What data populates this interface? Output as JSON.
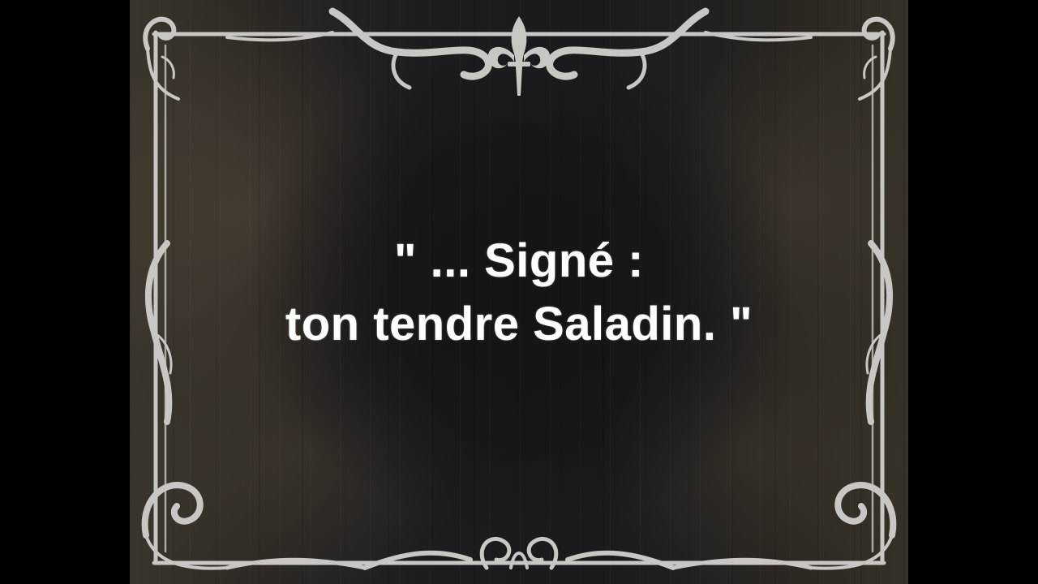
{
  "intertitle": {
    "line1": "\" ... Signé :",
    "line2": "ton tendre Saladin. \""
  },
  "colors": {
    "background": "#1c1a1c",
    "text": "#ffffff",
    "ornament": "#c9c7c4",
    "letterbox": "#000000"
  },
  "icons": {
    "top_center": "fleur-de-lis-icon",
    "frame": "ornamental-frame-border"
  }
}
